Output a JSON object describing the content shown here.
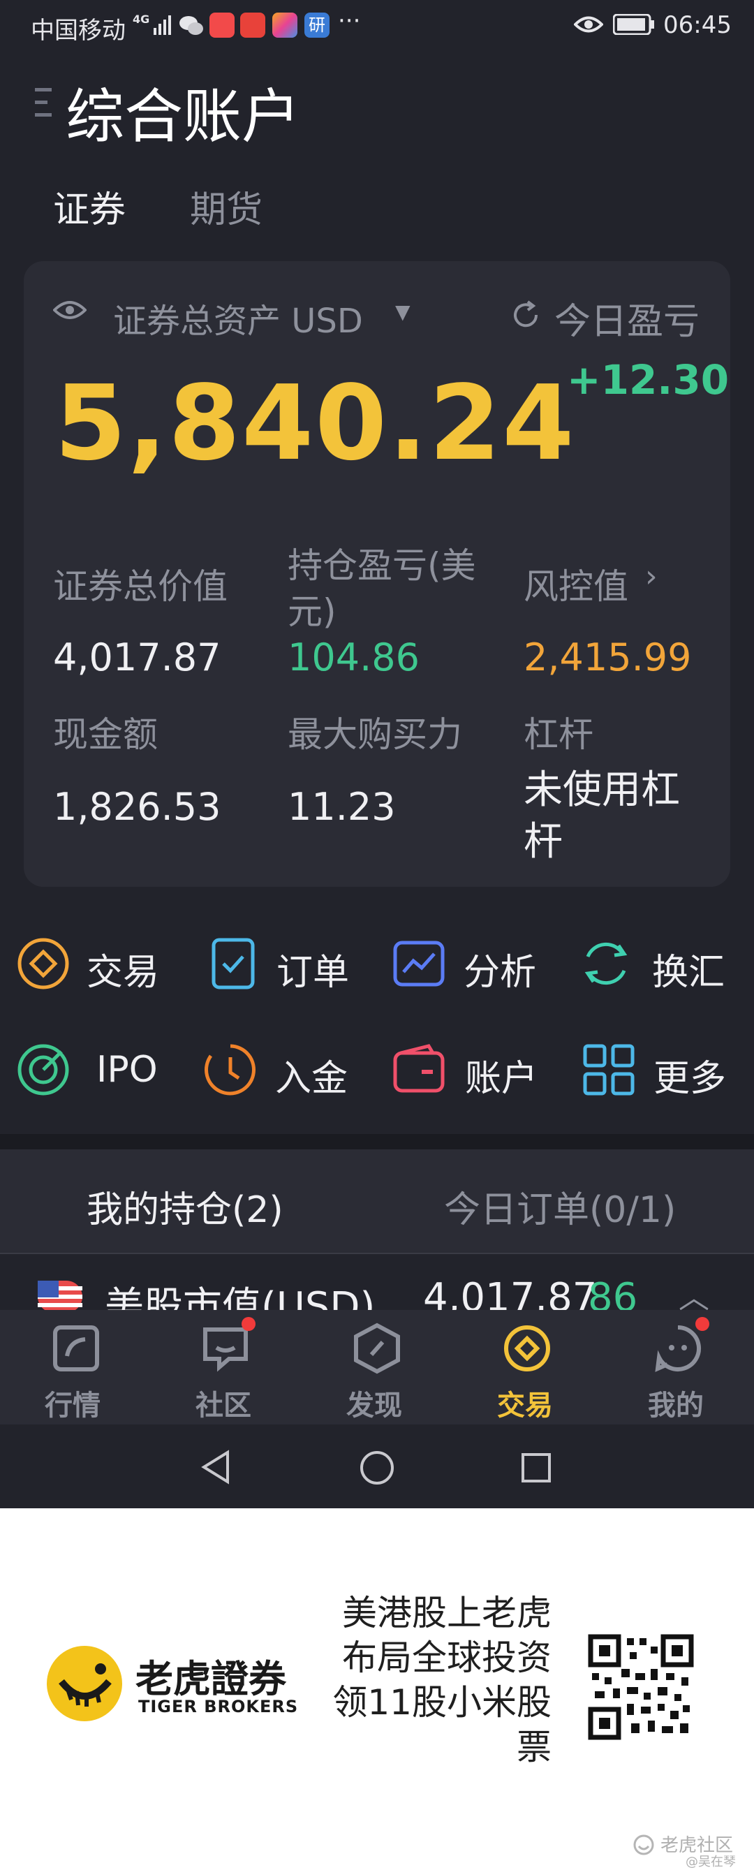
{
  "status_bar": {
    "carrier": "中国移动",
    "network": "4G",
    "time": "06:45",
    "icons": [
      "wechat-icon",
      "app-icon-red",
      "app-icon-huawei",
      "app-icon-colorful",
      "app-icon-yan",
      "more-dots-icon",
      "eye-icon",
      "battery-icon"
    ]
  },
  "header": {
    "title": "综合账户",
    "tabs": [
      {
        "label": "证券",
        "active": true
      },
      {
        "label": "期货",
        "active": false
      }
    ]
  },
  "summary": {
    "asset_label": "证券总资产 USD",
    "total_assets": "5,840.24",
    "today_pnl_label": "今日盈亏",
    "today_pnl": "+12.30",
    "metrics": [
      {
        "label": "证券总价值",
        "value": "4,017.87",
        "color": "#f0f0f3"
      },
      {
        "label_line1": "持仓盈亏(美",
        "label_line2": "元)",
        "value": "104.86",
        "color": "#3fc88f"
      },
      {
        "label": "风控值",
        "value": "2,415.99",
        "color": "#f2a53a"
      },
      {
        "label": "现金额",
        "value": "1,826.53",
        "color": "#f0f0f3"
      },
      {
        "label": "最大购买力",
        "value": "11.23",
        "color": "#f0f0f3"
      },
      {
        "label": "杠杆",
        "value_line1": "未使用杠",
        "value_line2": "杆",
        "color": "#f0f0f3"
      }
    ]
  },
  "functions": [
    {
      "label": "交易",
      "icon": "trade-icon",
      "color": "#f2a53a"
    },
    {
      "label": "订单",
      "icon": "order-icon",
      "color": "#4db8e8"
    },
    {
      "label": "分析",
      "icon": "analysis-icon",
      "color": "#5b7cf5"
    },
    {
      "label": "换汇",
      "icon": "exchange-icon",
      "color": "#3fd0b0"
    },
    {
      "label": "IPO",
      "icon": "ipo-icon",
      "color": "#3fc88f"
    },
    {
      "label": "入金",
      "icon": "deposit-icon",
      "color": "#f0822a"
    },
    {
      "label": "账户",
      "icon": "account-icon",
      "color": "#f0506a"
    },
    {
      "label": "更多",
      "icon": "more-grid-icon",
      "color": "#4db8e8"
    }
  ],
  "positions": {
    "tabs": [
      {
        "label": "我的持仓(2)",
        "active": true
      },
      {
        "label": "今日订单(0/1)",
        "active": false
      }
    ],
    "row_label": "美股市值(USD)",
    "row_value": "4,017.87",
    "row_value_overlap": "86"
  },
  "tabbar": {
    "items": [
      {
        "label": "行情",
        "icon": "market-icon",
        "active": false,
        "badge": false
      },
      {
        "label": "社区",
        "icon": "community-icon",
        "active": false,
        "badge": true
      },
      {
        "label": "发现",
        "icon": "discover-icon",
        "active": false,
        "badge": false
      },
      {
        "label": "交易",
        "icon": "trade-tab-icon",
        "active": true,
        "badge": false
      },
      {
        "label": "我的",
        "icon": "profile-icon",
        "active": false,
        "badge": true
      }
    ],
    "active_color": "#f3c33a",
    "badge_color": "#f23b3b"
  },
  "banner": {
    "brand_cn": "老虎證券",
    "brand_en": "TIGER BROKERS",
    "promo_lines": [
      "美港股上老虎",
      "布局全球投资",
      "领11股小米股",
      "票"
    ],
    "watermark": "老虎社区",
    "watermark_user": "@吴在琴"
  }
}
